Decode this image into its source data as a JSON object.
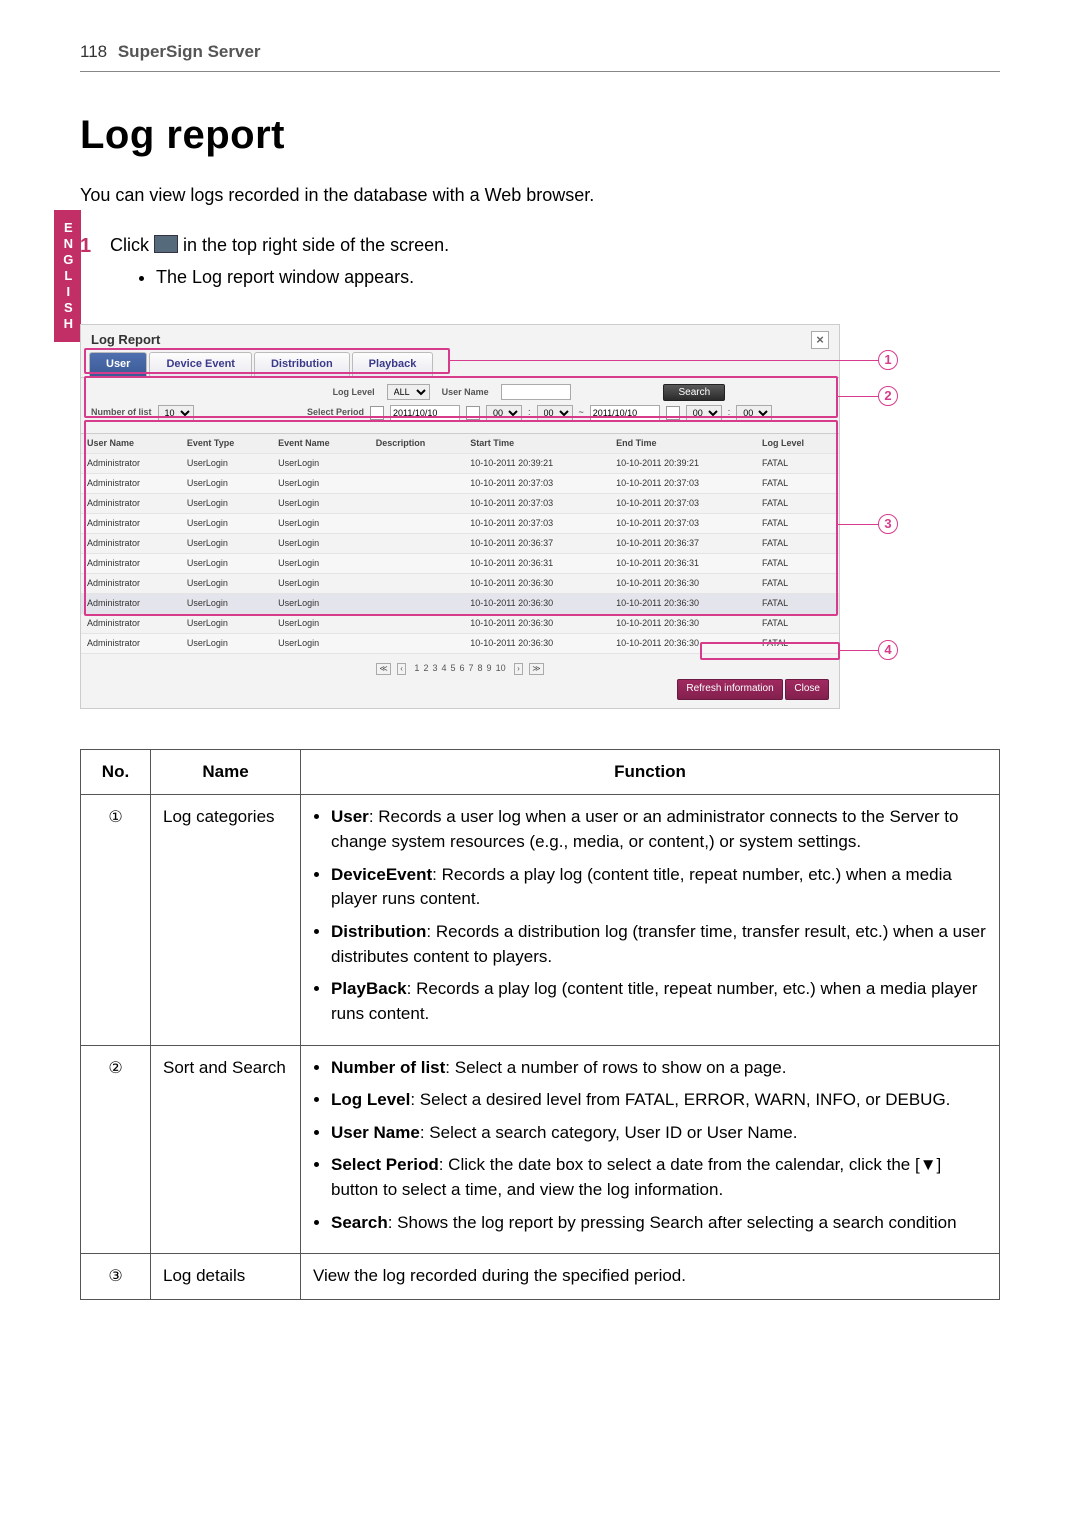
{
  "header": {
    "page_number": "118",
    "title": "SuperSign Server"
  },
  "lang_tab": "ENGLISH",
  "heading": "Log report",
  "intro": "You can view logs recorded in the database with a Web browser.",
  "step1_num": "1",
  "step1_pre": "Click ",
  "step1_post": " in the top right side of the screen.",
  "step1_sub": "The Log report window appears.",
  "win": {
    "title": "Log Report",
    "close": "×",
    "tabs": [
      "User",
      "Device Event",
      "Distribution",
      "Playback"
    ],
    "filters": {
      "numlist_label": "Number of list",
      "numlist_value": "10",
      "loglevel_label": "Log Level",
      "loglevel_value": "ALL",
      "username_label": "User Name",
      "username_value": "",
      "search_btn": "Search",
      "period_label": "Select Period",
      "date1": "2011/10/10",
      "h1": "00",
      "m1": "00",
      "sep": "~",
      "date2": "2011/10/10",
      "h2": "00",
      "m2": "00"
    },
    "cols": [
      "User Name",
      "Event Type",
      "Event Name",
      "Description",
      "Start Time",
      "End Time",
      "Log Level"
    ],
    "rows": [
      {
        "u": "Administrator",
        "et": "UserLogin",
        "en": "UserLogin",
        "d": "",
        "st": "10-10-2011 20:39:21",
        "ed": "10-10-2011 20:39:21",
        "lv": "FATAL"
      },
      {
        "u": "Administrator",
        "et": "UserLogin",
        "en": "UserLogin",
        "d": "",
        "st": "10-10-2011 20:37:03",
        "ed": "10-10-2011 20:37:03",
        "lv": "FATAL"
      },
      {
        "u": "Administrator",
        "et": "UserLogin",
        "en": "UserLogin",
        "d": "",
        "st": "10-10-2011 20:37:03",
        "ed": "10-10-2011 20:37:03",
        "lv": "FATAL"
      },
      {
        "u": "Administrator",
        "et": "UserLogin",
        "en": "UserLogin",
        "d": "",
        "st": "10-10-2011 20:37:03",
        "ed": "10-10-2011 20:37:03",
        "lv": "FATAL"
      },
      {
        "u": "Administrator",
        "et": "UserLogin",
        "en": "UserLogin",
        "d": "",
        "st": "10-10-2011 20:36:37",
        "ed": "10-10-2011 20:36:37",
        "lv": "FATAL"
      },
      {
        "u": "Administrator",
        "et": "UserLogin",
        "en": "UserLogin",
        "d": "",
        "st": "10-10-2011 20:36:31",
        "ed": "10-10-2011 20:36:31",
        "lv": "FATAL"
      },
      {
        "u": "Administrator",
        "et": "UserLogin",
        "en": "UserLogin",
        "d": "",
        "st": "10-10-2011 20:36:30",
        "ed": "10-10-2011 20:36:30",
        "lv": "FATAL"
      },
      {
        "u": "Administrator",
        "et": "UserLogin",
        "en": "UserLogin",
        "d": "",
        "st": "10-10-2011 20:36:30",
        "ed": "10-10-2011 20:36:30",
        "lv": "FATAL",
        "hl": true
      },
      {
        "u": "Administrator",
        "et": "UserLogin",
        "en": "UserLogin",
        "d": "",
        "st": "10-10-2011 20:36:30",
        "ed": "10-10-2011 20:36:30",
        "lv": "FATAL"
      },
      {
        "u": "Administrator",
        "et": "UserLogin",
        "en": "UserLogin",
        "d": "",
        "st": "10-10-2011 20:36:30",
        "ed": "10-10-2011 20:36:30",
        "lv": "FATAL"
      }
    ],
    "pager": [
      "1",
      "2",
      "3",
      "4",
      "5",
      "6",
      "7",
      "8",
      "9",
      "10"
    ],
    "footer": {
      "refresh": "Refresh information",
      "close": "Close"
    }
  },
  "callouts": {
    "c1": "1",
    "c2": "2",
    "c3": "3",
    "c4": "4"
  },
  "desc": {
    "head": {
      "no": "No.",
      "name": "Name",
      "func": "Function"
    },
    "r1": {
      "no": "①",
      "name": "Log categories",
      "b1a": "User",
      "b1b": ": Records a user log when a user or an administrator connects to the Server to change system resources (e.g., media, or content,) or system settings.",
      "b2a": "DeviceEvent",
      "b2b": ": Records a play log (content title, repeat number, etc.) when a media player runs content.",
      "b3a": "Distribution",
      "b3b": ": Records a distribution log (transfer time, transfer result, etc.) when a user distributes content to players.",
      "b4a": "PlayBack",
      "b4b": ": Records a play log (content title, repeat number, etc.) when a media player runs content."
    },
    "r2": {
      "no": "②",
      "name": "Sort and Search",
      "b1a": "Number of list",
      "b1b": ": Select a number of rows to show on a page.",
      "b2a": "Log Level",
      "b2b": ": Select a desired level from FATAL, ERROR, WARN, INFO, or DEBUG.",
      "b3a": "User Name",
      "b3b": ": Select a search category, User ID or User Name.",
      "b4a": "Select Period",
      "b4b": ": Click the date box to select a date from the calendar, click the [▼] button to select a time, and view the log information.",
      "b5a": "Search",
      "b5b": ": Shows the log report by pressing Search after selecting a search condition"
    },
    "r3": {
      "no": "③",
      "name": "Log details",
      "func": "View the log recorded during the specified period."
    }
  }
}
